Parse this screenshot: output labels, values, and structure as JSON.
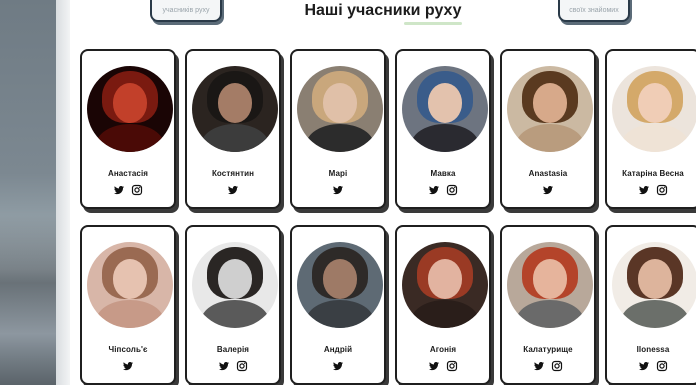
{
  "header": {
    "title": "Наші учасники руху",
    "left_button": "учасників руху",
    "right_button": "своїх знайомих"
  },
  "colors": {
    "card_border": "#1f1f1f",
    "underline": "#cfe6c8",
    "text": "#1a1a1a"
  },
  "members": [
    {
      "name": "Анастасія",
      "links": [
        "twitter-icon",
        "instagram-icon"
      ],
      "palette": {
        "bg": "#1a0505",
        "hair": "#7a1a10",
        "face": "#c2402a",
        "body": "#4a0a06"
      }
    },
    {
      "name": "Костянтин",
      "links": [
        "twitter-icon"
      ],
      "palette": {
        "bg": "#2b2420",
        "hair": "#1a1715",
        "face": "#a47c66",
        "body": "#3c3c3c"
      }
    },
    {
      "name": "Марі",
      "links": [
        "twitter-icon"
      ],
      "palette": {
        "bg": "#8a7f72",
        "hair": "#c9a77c",
        "face": "#e0c0a8",
        "body": "#2c2c2c"
      }
    },
    {
      "name": "Мавка",
      "links": [
        "twitter-icon",
        "instagram-icon"
      ],
      "palette": {
        "bg": "#6d7480",
        "hair": "#3a5c8a",
        "face": "#e3c2ad",
        "body": "#2a2a30"
      }
    },
    {
      "name": "Anastasia",
      "links": [
        "twitter-icon"
      ],
      "palette": {
        "bg": "#cbb9a2",
        "hair": "#5a3a20",
        "face": "#d7a98a",
        "body": "#b99c7e"
      }
    },
    {
      "name": "Катаріна Весна",
      "links": [
        "twitter-icon",
        "instagram-icon"
      ],
      "palette": {
        "bg": "#ece4dc",
        "hair": "#d4a96a",
        "face": "#f0cdb6",
        "body": "#efe3d6"
      }
    },
    {
      "name": "Чіпсоль'є",
      "links": [
        "twitter-icon"
      ],
      "palette": {
        "bg": "#d8b6a8",
        "hair": "#9a6a52",
        "face": "#e6c2b0",
        "body": "#c79a88"
      }
    },
    {
      "name": "Валерія",
      "links": [
        "twitter-icon",
        "instagram-icon"
      ],
      "palette": {
        "bg": "#e8e8e8",
        "hair": "#2a2624",
        "face": "#cfcfcf",
        "body": "#5a5a5a"
      }
    },
    {
      "name": "Андрій",
      "links": [
        "twitter-icon"
      ],
      "palette": {
        "bg": "#5e6a74",
        "hair": "#2e2a28",
        "face": "#9e7a66",
        "body": "#3a3f44"
      }
    },
    {
      "name": "Агонія",
      "links": [
        "twitter-icon",
        "instagram-icon"
      ],
      "palette": {
        "bg": "#3a2a24",
        "hair": "#9a3a24",
        "face": "#e2b3a0",
        "body": "#2a1e1a"
      }
    },
    {
      "name": "Калатурище",
      "links": [
        "twitter-icon",
        "instagram-icon"
      ],
      "palette": {
        "bg": "#b8a89a",
        "hair": "#b4442a",
        "face": "#e6b49c",
        "body": "#6a6a6a"
      }
    },
    {
      "name": "Ilonessa",
      "links": [
        "twitter-icon",
        "instagram-icon"
      ],
      "palette": {
        "bg": "#f1ece6",
        "hair": "#5a3626",
        "face": "#ddb49c",
        "body": "#6b6f6a"
      }
    }
  ]
}
